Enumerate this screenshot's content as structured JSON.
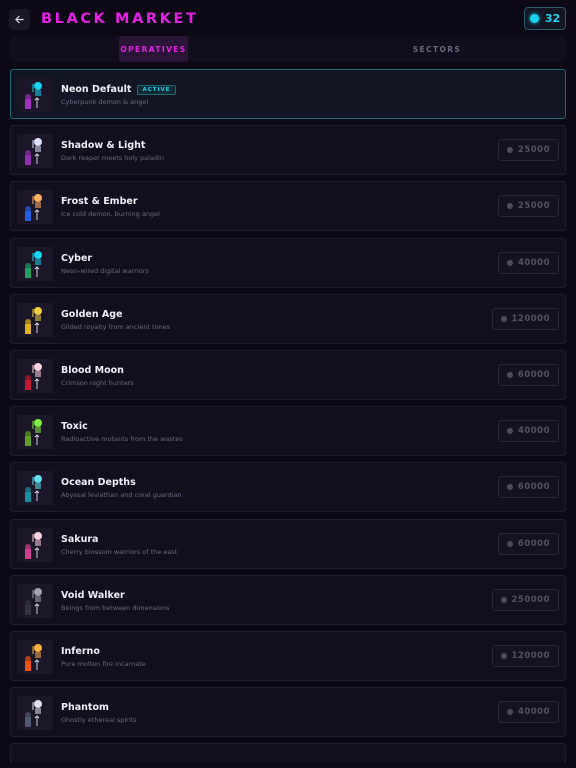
{
  "header": {
    "title": "BLACK MARKET",
    "currency_value": "32",
    "currency_color": "#18d4f0",
    "title_color": "#e621e6"
  },
  "tabs": [
    {
      "label": "OPERATIVES",
      "active": true
    },
    {
      "label": "SECTORS",
      "active": false
    }
  ],
  "skins": [
    {
      "name": "Neon Default",
      "desc": "Cyberpunk demon & angel",
      "active": true,
      "badge": "ACTIVE",
      "color": "#18d4f0",
      "accent": "#a030c0"
    },
    {
      "name": "Shadow & Light",
      "desc": "Dark reaper meets holy paladin",
      "price": "25000",
      "color": "#e0e0ff",
      "accent": "#9030b0"
    },
    {
      "name": "Frost & Ember",
      "desc": "Ice cold demon, burning angel",
      "price": "25000",
      "color": "#ffb060",
      "accent": "#2060e0"
    },
    {
      "name": "Cyber",
      "desc": "Neon-wired digital warriors",
      "price": "40000",
      "color": "#18d4f0",
      "accent": "#20a060"
    },
    {
      "name": "Golden Age",
      "desc": "Gilded royalty from ancient times",
      "price": "120000",
      "color": "#f0d040",
      "accent": "#e0b020"
    },
    {
      "name": "Blood Moon",
      "desc": "Crimson night hunters",
      "price": "60000",
      "color": "#ffd0e0",
      "accent": "#c01830"
    },
    {
      "name": "Toxic",
      "desc": "Radioactive mutants from the wastes",
      "price": "40000",
      "color": "#80f040",
      "accent": "#60a020"
    },
    {
      "name": "Ocean Depths",
      "desc": "Abyssal leviathan and coral guardian",
      "price": "60000",
      "color": "#60e0f0",
      "accent": "#1890a0"
    },
    {
      "name": "Sakura",
      "desc": "Cherry blossom warriors of the east",
      "price": "60000",
      "color": "#ffd0e0",
      "accent": "#d04090"
    },
    {
      "name": "Void Walker",
      "desc": "Beings from between dimensions",
      "price": "250000",
      "color": "#a0a0b0",
      "accent": "#303040"
    },
    {
      "name": "Inferno",
      "desc": "Pure molten fire incarnate",
      "price": "120000",
      "color": "#ffb040",
      "accent": "#f05010"
    },
    {
      "name": "Phantom",
      "desc": "Ghostly ethereal spirits",
      "price": "40000",
      "color": "#e0e0f0",
      "accent": "#505870"
    }
  ]
}
